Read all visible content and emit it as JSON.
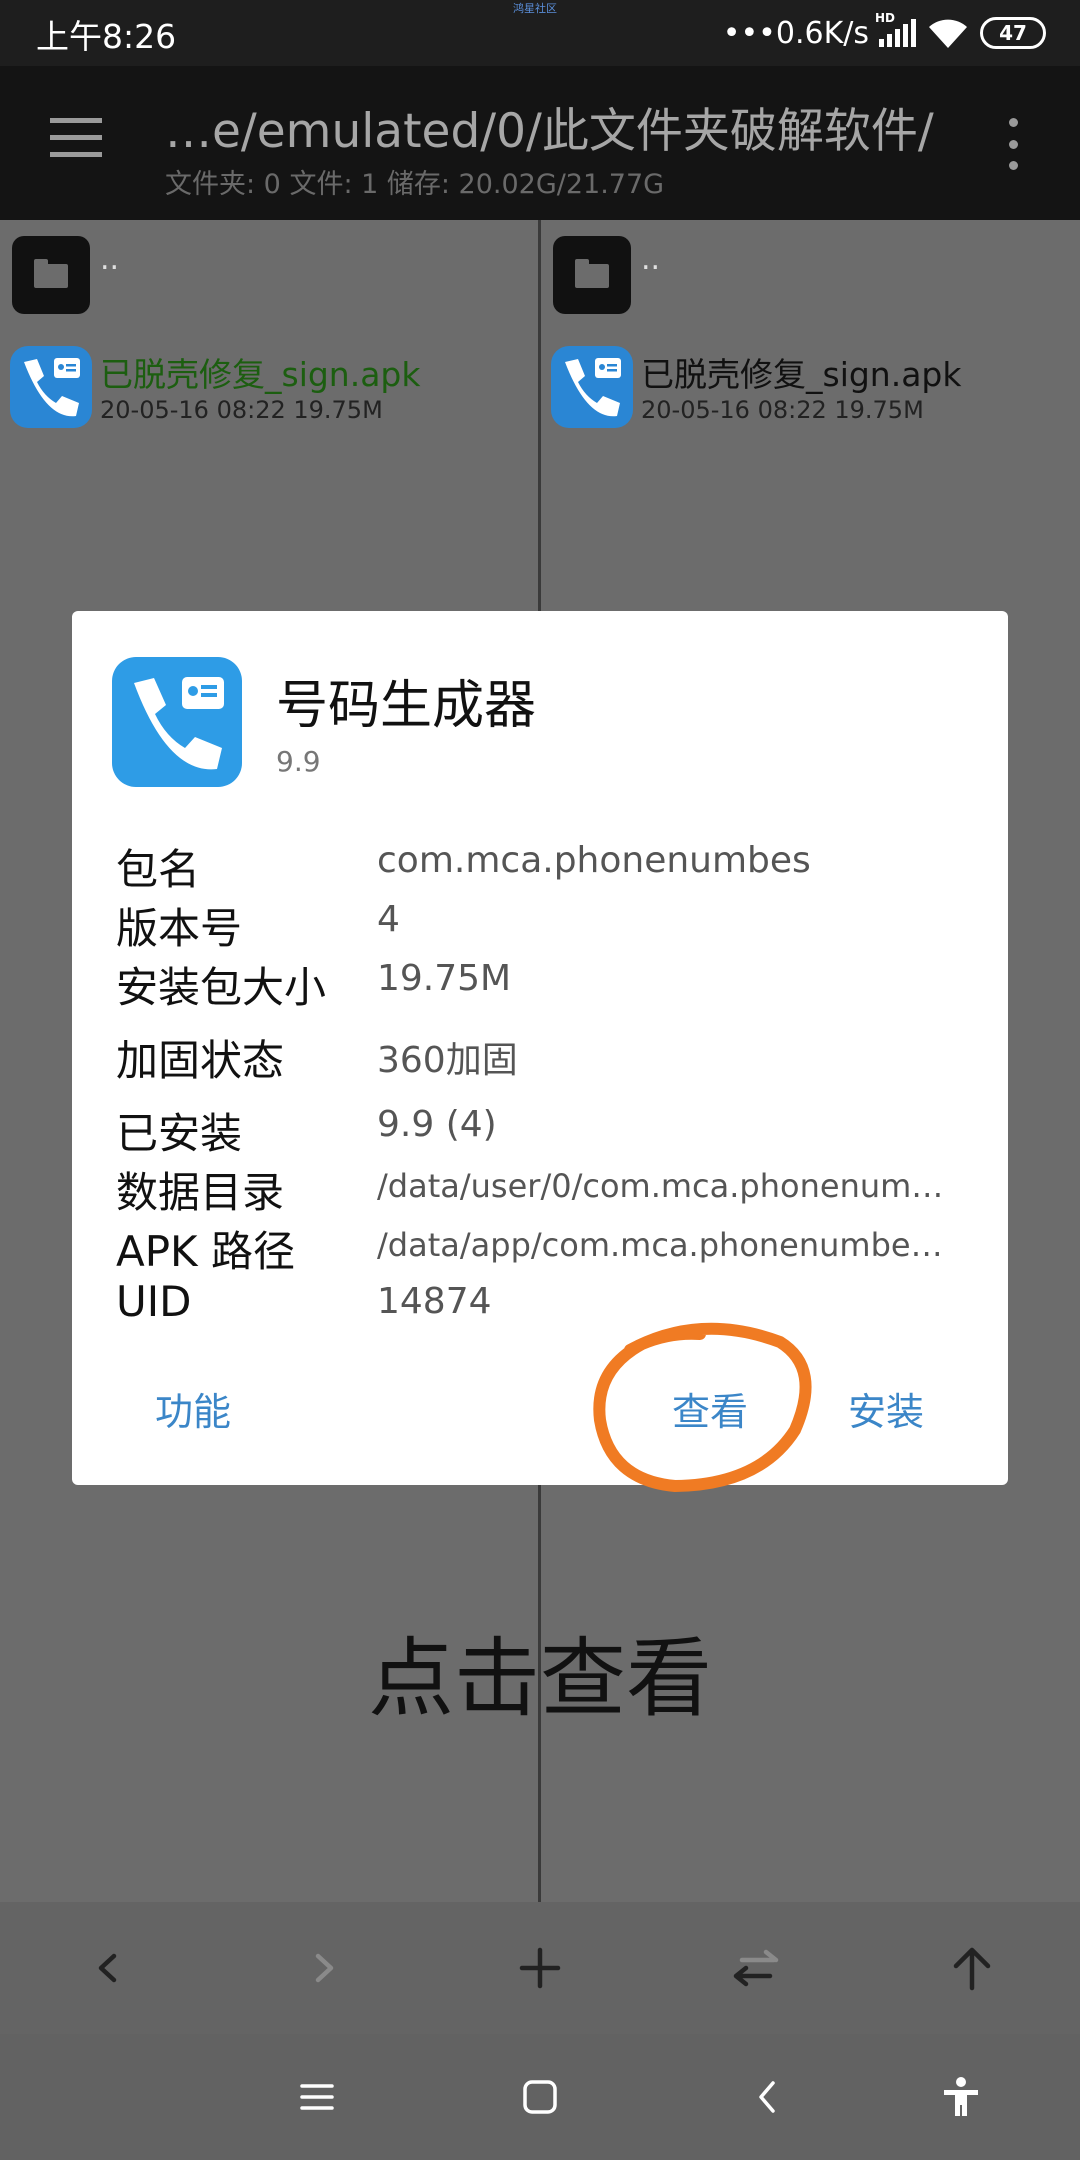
{
  "status_bar": {
    "time": "上午8:26",
    "watermark": "鸿星社区",
    "net_speed": "•••0.6K/s",
    "network_label": "HD",
    "battery": "47",
    "wifi_icon": "wifi-icon",
    "signal_icon": "signal-icon"
  },
  "toolbar": {
    "path": "…e/emulated/0/此文件夹破解软件/",
    "stats": "文件夹: 0  文件: 1  储存: 20.02G/21.77G",
    "menu_icon": "hamburger-menu-icon",
    "more_icon": "more-vertical-icon"
  },
  "panes": {
    "left": {
      "up_label": "..",
      "file_name": "已脱壳修复_sign.apk",
      "file_meta": "20-05-16 08:22  19.75M",
      "name_color": "#1c5e10"
    },
    "right": {
      "up_label": "..",
      "file_name": "已脱壳修复_sign.apk",
      "file_meta": "20-05-16 08:22  19.75M"
    }
  },
  "dialog": {
    "app_name": "号码生成器",
    "app_version": "9.9",
    "rows": [
      {
        "label": "包名",
        "value": "com.mca.phonenumbes"
      },
      {
        "label": "版本号",
        "value": "4"
      },
      {
        "label": "安装包大小",
        "value": "19.75M"
      },
      {
        "label": "加固状态",
        "value": "360加固"
      },
      {
        "label": "已安装",
        "value": "9.9 (4)"
      },
      {
        "label": "数据目录",
        "value": "/data/user/0/com.mca.phonenum…"
      },
      {
        "label": "APK 路径",
        "value": "/data/app/com.mca.phonenumbe…"
      },
      {
        "label": "UID",
        "value": "14874"
      }
    ],
    "buttons": {
      "functions": "功能",
      "view": "查看",
      "install": "安装"
    },
    "accent_color": "#3b86c8",
    "annotation_color": "#f07b23"
  },
  "caption": "点击查看",
  "action_bar": {
    "icons": [
      "chevron-left-icon",
      "chevron-right-icon",
      "plus-icon",
      "swap-icon",
      "arrow-up-icon"
    ]
  },
  "nav_bar": {
    "icons": [
      "menu-icon",
      "home-icon",
      "back-icon",
      "accessibility-icon"
    ]
  }
}
